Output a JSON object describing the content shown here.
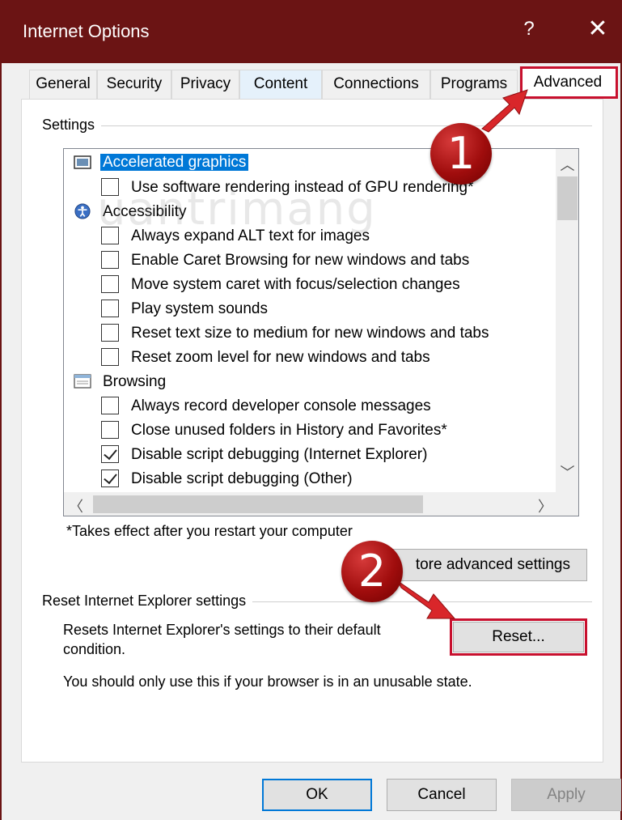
{
  "window": {
    "title": "Internet Options",
    "help_glyph": "?",
    "close_glyph": "✕",
    "title_bar_color": "#6b1414"
  },
  "tabs": [
    {
      "label": "General"
    },
    {
      "label": "Security"
    },
    {
      "label": "Privacy"
    },
    {
      "label": "Content"
    },
    {
      "label": "Connections"
    },
    {
      "label": "Programs"
    },
    {
      "label": "Advanced"
    }
  ],
  "active_tab": "Advanced",
  "settings": {
    "group_label": "Settings",
    "categories": [
      {
        "label": "Accelerated graphics",
        "icon": "display-icon",
        "selected": true
      },
      {
        "label": "Accessibility",
        "icon": "accessibility-icon"
      },
      {
        "label": "Browsing",
        "icon": "browsing-icon"
      }
    ],
    "options": [
      {
        "label": "Use software rendering instead of GPU rendering*",
        "checked": false
      },
      {
        "label": "Always expand ALT text for images",
        "checked": false
      },
      {
        "label": "Enable Caret Browsing for new windows and tabs",
        "checked": false
      },
      {
        "label": "Move system caret with focus/selection changes",
        "checked": false
      },
      {
        "label": "Play system sounds",
        "checked": false
      },
      {
        "label": "Reset text size to medium for new windows and tabs",
        "checked": false
      },
      {
        "label": "Reset zoom level for new windows and tabs",
        "checked": false
      },
      {
        "label": "Always record developer console messages",
        "checked": false
      },
      {
        "label": "Close unused folders in History and Favorites*",
        "checked": false
      },
      {
        "label": "Disable script debugging (Internet Explorer)",
        "checked": true
      },
      {
        "label": "Disable script debugging (Other)",
        "checked": true
      }
    ],
    "restart_note": "*Takes effect after you restart your computer",
    "restore_button": "tore advanced settings"
  },
  "reset": {
    "group_label": "Reset Internet Explorer settings",
    "description_line1": "Resets Internet Explorer's settings to their default",
    "description_line2": "condition.",
    "warning": "You should only use this if your browser is in an unusable state.",
    "reset_button": "Reset..."
  },
  "footer": {
    "ok": "OK",
    "cancel": "Cancel",
    "apply": "Apply"
  },
  "annotations": {
    "step1": "1",
    "step2": "2",
    "marker_color": "#c8102e",
    "watermark": "uantrimang"
  },
  "colors": {
    "selection": "#0078d7",
    "active_tab_highlight": "#e5f1fb"
  }
}
